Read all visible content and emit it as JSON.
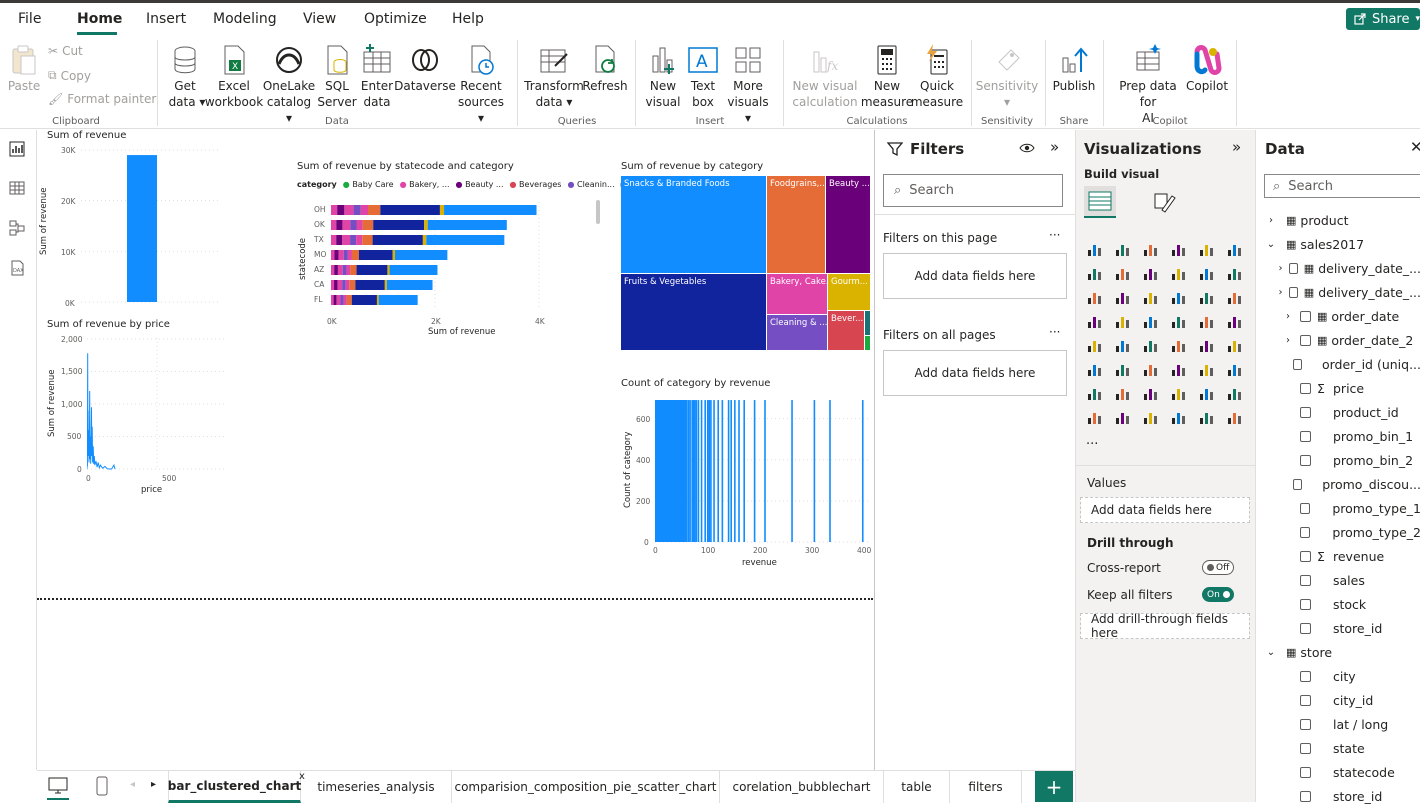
{
  "menu": {
    "items": [
      "File",
      "Home",
      "Insert",
      "Modeling",
      "View",
      "Optimize",
      "Help"
    ],
    "share_label": "Share"
  },
  "ribbon": {
    "clipboard": {
      "paste": "Paste",
      "cut": "Cut",
      "copy": "Copy",
      "format_painter": "Format painter",
      "group": "Clipboard"
    },
    "data": {
      "get_data": [
        "Get",
        "data"
      ],
      "excel": [
        "Excel",
        "workbook"
      ],
      "onelake": [
        "OneLake",
        "catalog"
      ],
      "sql": [
        "SQL",
        "Server"
      ],
      "enter": [
        "Enter",
        "data"
      ],
      "dataverse": "Dataverse",
      "recent": [
        "Recent",
        "sources"
      ],
      "group": "Data"
    },
    "queries": {
      "transform": [
        "Transform",
        "data"
      ],
      "refresh": "Refresh",
      "group": "Queries"
    },
    "insert": {
      "new_visual": [
        "New",
        "visual"
      ],
      "text_box": [
        "Text",
        "box"
      ],
      "more_visuals": [
        "More",
        "visuals"
      ],
      "group": "Insert"
    },
    "calculations": {
      "new_visual_calc": [
        "New visual",
        "calculation"
      ],
      "new_measure": [
        "New",
        "measure"
      ],
      "quick_measure": [
        "Quick",
        "measure"
      ],
      "group": "Calculations"
    },
    "sensitivity": {
      "label": "Sensitivity",
      "group": "Sensitivity"
    },
    "share": {
      "publish": "Publish",
      "group": "Share"
    },
    "copilot": {
      "prep": [
        "Prep data for",
        "AI"
      ],
      "copilot": "Copilot",
      "group": "Copilot"
    }
  },
  "charts": {
    "c1": {
      "title": "Sum of revenue",
      "ylabel": "Sum of revenue",
      "ticks": [
        "30K",
        "20K",
        "10K",
        "0K"
      ]
    },
    "c2": {
      "title": "Sum of revenue by statecode and category",
      "legend_title": "category",
      "legend": [
        "Baby Care",
        "Bakery, ...",
        "Beauty ...",
        "Beverages",
        "Cleanin..."
      ],
      "ylabel": "statecode",
      "xlabel": "Sum of revenue",
      "xticks": [
        "0K",
        "2K",
        "4K"
      ]
    },
    "c3": {
      "title": "Sum of revenue by category",
      "tiles": [
        "Snacks & Branded Foods",
        "Foodgrains,...",
        "Beauty ...",
        "Fruits & Vegetables",
        "Bakery, Cake...",
        "Gourm...",
        "Cleaning & ...",
        "Bever..."
      ]
    },
    "c4": {
      "title": "Sum of revenue by price",
      "ylabel": "Sum of revenue",
      "xlabel": "price",
      "yticks": [
        "2,000",
        "1,500",
        "1,000",
        "500",
        "0"
      ],
      "xticks": [
        "0",
        "500"
      ]
    },
    "c5": {
      "title": "Count of category by revenue",
      "ylabel": "Count of category",
      "xlabel": "revenue",
      "yticks": [
        "600",
        "400",
        "200",
        "0"
      ],
      "xticks": [
        "0",
        "100",
        "200",
        "300",
        "400"
      ]
    }
  },
  "chart_data": [
    {
      "type": "bar",
      "title": "Sum of revenue",
      "ylabel": "Sum of revenue",
      "categories": [
        ""
      ],
      "values": [
        29000
      ],
      "ylim": [
        0,
        30000
      ]
    },
    {
      "type": "bar",
      "title": "Sum of revenue by statecode and category",
      "ylabel": "statecode",
      "xlabel": "Sum of revenue",
      "categories": [
        "OH",
        "OK",
        "TX",
        "MO",
        "AZ",
        "CA",
        "FL"
      ],
      "totals": [
        4150,
        3550,
        3500,
        2350,
        2150,
        2050,
        1750
      ],
      "xlim": [
        0,
        4200
      ]
    },
    {
      "type": "heatmap",
      "title": "Sum of revenue by category",
      "categories": [
        "Snacks & Branded Foods",
        "Fruits & Vegetables",
        "Foodgrains,...",
        "Beauty ...",
        "Bakery, Cake...",
        "Gourm...",
        "Cleaning & ...",
        "Bever..."
      ]
    },
    {
      "type": "line",
      "title": "Sum of revenue by price",
      "xlabel": "price",
      "ylabel": "Sum of revenue",
      "ylim": [
        0,
        2000
      ],
      "xlim": [
        0,
        700
      ]
    },
    {
      "type": "bar",
      "title": "Count of category by revenue",
      "xlabel": "revenue",
      "ylabel": "Count of category",
      "ylim": [
        0,
        700
      ],
      "xlim": [
        0,
        400
      ]
    }
  ],
  "filters": {
    "title": "Filters",
    "search_placeholder": "Search",
    "this_page": "Filters on this page",
    "all_pages": "Filters on all pages",
    "add_fields": "Add data fields here"
  },
  "viz": {
    "title": "Visualizations",
    "build": "Build visual",
    "values": "Values",
    "add_fields": "Add data fields here",
    "drill": "Drill through",
    "cross_report": "Cross-report",
    "cross_state": "Off",
    "keep_filters": "Keep all filters",
    "keep_state": "On",
    "add_drill": "Add drill-through fields here",
    "more": "..."
  },
  "data_pane": {
    "title": "Data",
    "search_placeholder": "Search",
    "items": [
      {
        "label": "product",
        "kind": "table",
        "level": 0,
        "expanded": false
      },
      {
        "label": "sales2017",
        "kind": "table",
        "level": 0,
        "expanded": true
      },
      {
        "label": "delivery_date_...",
        "kind": "date",
        "level": 1
      },
      {
        "label": "delivery_date_...",
        "kind": "date",
        "level": 1
      },
      {
        "label": "order_date",
        "kind": "date",
        "level": 1
      },
      {
        "label": "order_date_2",
        "kind": "date",
        "level": 1
      },
      {
        "label": "order_id (uniq...",
        "kind": "field",
        "level": 1
      },
      {
        "label": "price",
        "kind": "sum",
        "level": 1
      },
      {
        "label": "product_id",
        "kind": "field",
        "level": 1
      },
      {
        "label": "promo_bin_1",
        "kind": "field",
        "level": 1
      },
      {
        "label": "promo_bin_2",
        "kind": "field",
        "level": 1
      },
      {
        "label": "promo_discou...",
        "kind": "field",
        "level": 1
      },
      {
        "label": "promo_type_1",
        "kind": "field",
        "level": 1
      },
      {
        "label": "promo_type_2",
        "kind": "field",
        "level": 1
      },
      {
        "label": "revenue",
        "kind": "sum",
        "level": 1
      },
      {
        "label": "sales",
        "kind": "field",
        "level": 1
      },
      {
        "label": "stock",
        "kind": "field",
        "level": 1
      },
      {
        "label": "store_id",
        "kind": "field",
        "level": 1
      },
      {
        "label": "store",
        "kind": "table",
        "level": 0,
        "expanded": true
      },
      {
        "label": "city",
        "kind": "field",
        "level": 1
      },
      {
        "label": "city_id",
        "kind": "field",
        "level": 1
      },
      {
        "label": "lat / long",
        "kind": "field",
        "level": 1
      },
      {
        "label": "state",
        "kind": "field",
        "level": 1
      },
      {
        "label": "statecode",
        "kind": "field",
        "level": 1
      },
      {
        "label": "store_id",
        "kind": "field",
        "level": 1
      }
    ]
  },
  "tabs": {
    "items": [
      "bar_clustered_chart",
      "timeseries_analysis",
      "comparision_composition_pie_scatter_chart",
      "corelation_bubblechart",
      "table",
      "filters"
    ],
    "active": 0,
    "add": "+",
    "close": "x"
  },
  "colors": {
    "accent": "#117865",
    "pbi_blue": "#118DFF",
    "navy": "#12239E",
    "orange": "#E66C37",
    "purple": "#6B007B",
    "pink": "#E044A7",
    "violet": "#744EC2",
    "yellow": "#D9B300",
    "red": "#D64550"
  }
}
